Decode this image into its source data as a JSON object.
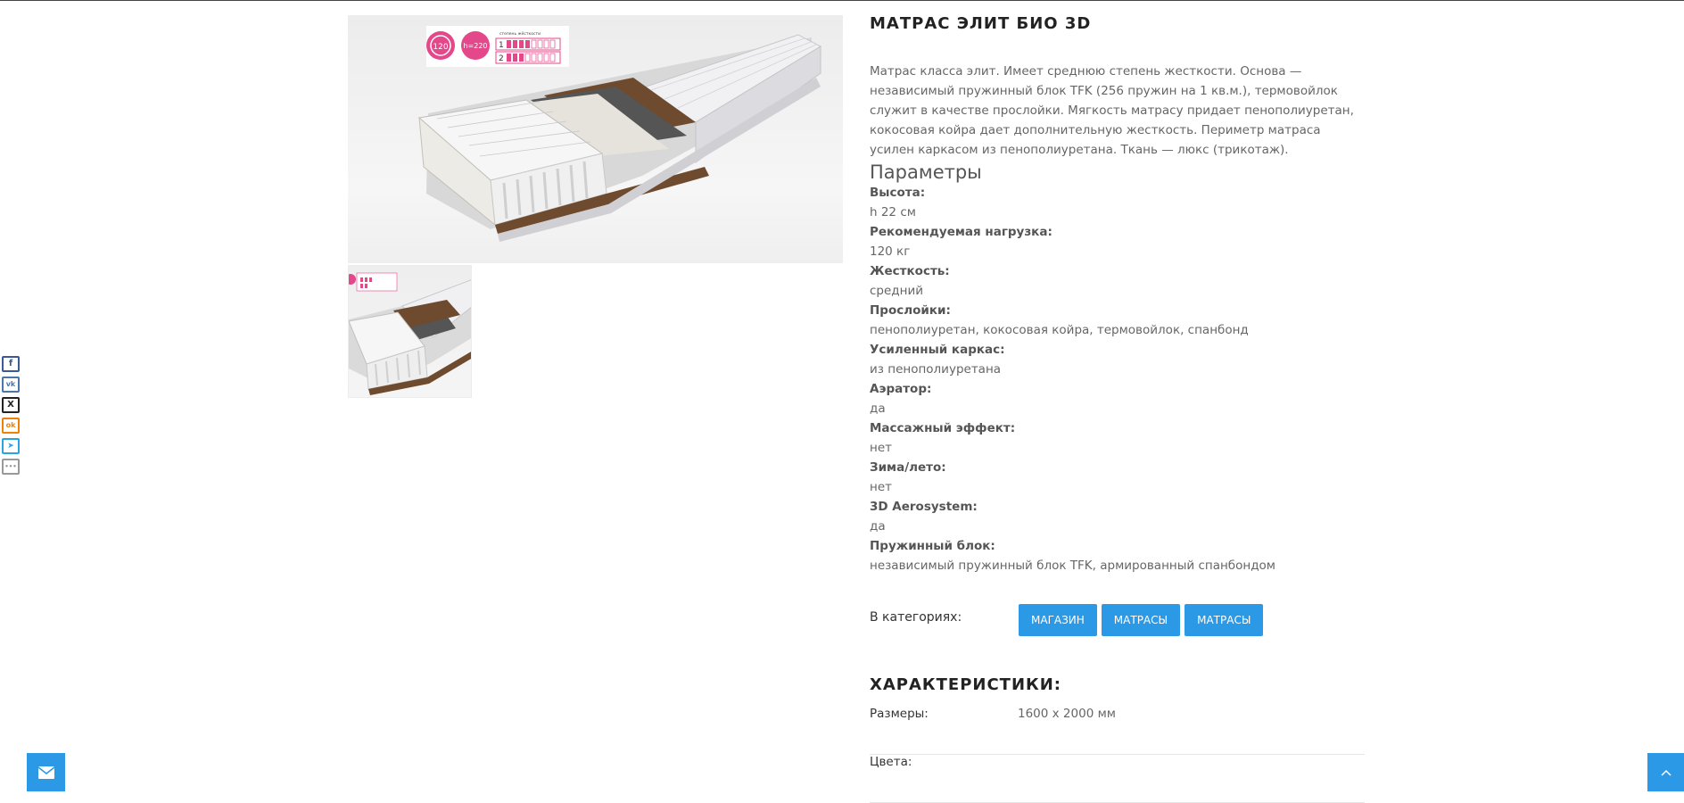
{
  "social": [
    {
      "icon": "facebook-icon",
      "glyph": "f",
      "color": "#3b5998"
    },
    {
      "icon": "vk-icon",
      "glyph": "vk",
      "color": "#4a76a8"
    },
    {
      "icon": "x-twitter-icon",
      "glyph": "X",
      "color": "#222222"
    },
    {
      "icon": "odnoklassniki-icon",
      "glyph": "ok",
      "color": "#ee8208"
    },
    {
      "icon": "telegram-icon",
      "glyph": "➤",
      "color": "#2aa3df"
    },
    {
      "icon": "more-icon",
      "glyph": "•••",
      "color": "#999999"
    }
  ],
  "badges": {
    "load": "120",
    "height": "h=220",
    "rating_title": "степень жёсткости",
    "rows": [
      "1",
      "2"
    ]
  },
  "product": {
    "title": "МАТРАС ЭЛИТ БИО 3D",
    "description": "Матрас класса элит. Имеет среднюю  степень жесткости. Основа — независимый пружинный блок TFK (256 пружин на 1 кв.м.), термовойлок служит в качестве прослойки. Мягкость матрасу придает пенополиуретан, кокосовая койра дает дополнительную жесткость. Периметр матраса усилен каркасом из пенополиуретана. Ткань — люкс (трикотаж).",
    "params_heading": "Параметры",
    "params": [
      {
        "label": "Высота:",
        "value": "h 22 см"
      },
      {
        "label": "Рекомендуемая нагрузка:",
        "value": "120 кг"
      },
      {
        "label": "Жесткость:",
        "value": "средний"
      },
      {
        "label": "Прослойки:",
        "value": "пенополиуретан, кокосовая койра, термовойлок, спанбонд"
      },
      {
        "label": "Усиленный каркас:",
        "value": "из пенополиуретана"
      },
      {
        "label": "Аэратор:",
        "value": "да"
      },
      {
        "label": "Массажный эффект:",
        "value": "нет"
      },
      {
        "label": "Зима/лето:",
        "value": "нет"
      },
      {
        "label": "3D Aerosystem:",
        "value": "да"
      },
      {
        "label": "Пружинный блок:",
        "value": "независимый пружинный блок TFK, армированный спанбондом"
      }
    ]
  },
  "categories": {
    "label": "В категориях:",
    "tags": [
      "МАГАЗИН",
      "МАТРАСЫ",
      "МАТРАСЫ"
    ]
  },
  "characteristics": {
    "title": "ХАРАКТЕРИСТИКИ:",
    "rows": [
      {
        "key": "Размеры:",
        "value": "1600 x 2000 мм"
      },
      {
        "key": "Цвета:",
        "value": ""
      }
    ]
  },
  "colors": {
    "accent": "#2b99e6"
  }
}
